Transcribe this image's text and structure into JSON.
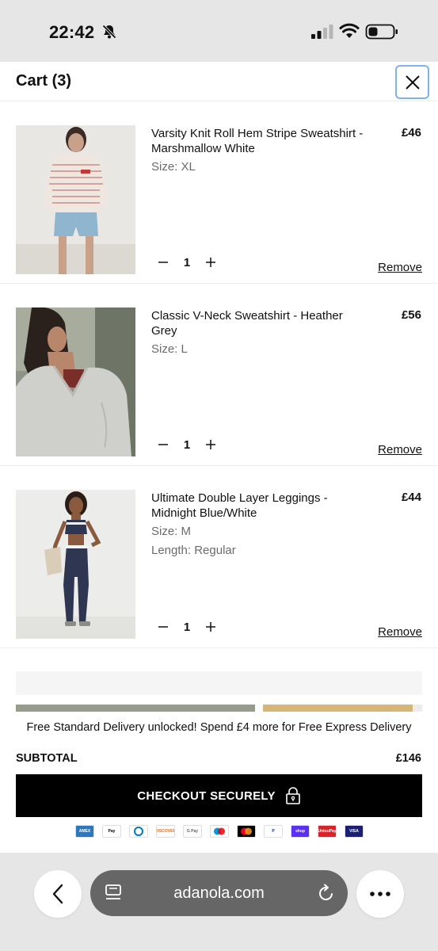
{
  "status_bar": {
    "time": "22:42"
  },
  "cart": {
    "title": "Cart (3)",
    "items": [
      {
        "name": "Varsity Knit Roll Hem Stripe Sweatshirt - Marshmallow White",
        "price": "£46",
        "size": "Size: XL",
        "quantity": "1",
        "remove_label": "Remove"
      },
      {
        "name": "Classic V-Neck Sweatshirt - Heather Grey",
        "price": "£56",
        "size": "Size: L",
        "quantity": "1",
        "remove_label": "Remove"
      },
      {
        "name": "Ultimate Double Layer Leggings - Midnight Blue/White",
        "price": "£44",
        "size": "Size: M",
        "length": "Length: Regular",
        "quantity": "1",
        "remove_label": "Remove"
      }
    ]
  },
  "delivery": {
    "message": "Free Standard Delivery unlocked! Spend £4 more for Free Express Delivery",
    "standard_color": "#959c8a",
    "express_color": "#d6b677"
  },
  "summary": {
    "subtotal_label": "SUBTOTAL",
    "subtotal_value": "£146",
    "checkout_label": "CHECKOUT SECURELY"
  },
  "payment_methods": [
    {
      "name": "amex-icon",
      "label": "AMEX"
    },
    {
      "name": "apple-pay-icon",
      "label": "Pay"
    },
    {
      "name": "diners-icon",
      "label": ""
    },
    {
      "name": "discover-icon",
      "label": "DISCOVER"
    },
    {
      "name": "google-pay-icon",
      "label": "G Pay"
    },
    {
      "name": "maestro-icon",
      "label": ""
    },
    {
      "name": "mastercard-icon",
      "label": ""
    },
    {
      "name": "paypal-icon",
      "label": "P"
    },
    {
      "name": "shop-pay-icon",
      "label": "shop"
    },
    {
      "name": "unionpay-icon",
      "label": "UnionPay"
    },
    {
      "name": "visa-icon",
      "label": "VISA"
    }
  ],
  "browser": {
    "url": "adanola.com"
  },
  "colors": {
    "accent_focus": "#7fb3e6",
    "checkout_bg": "#000000"
  }
}
